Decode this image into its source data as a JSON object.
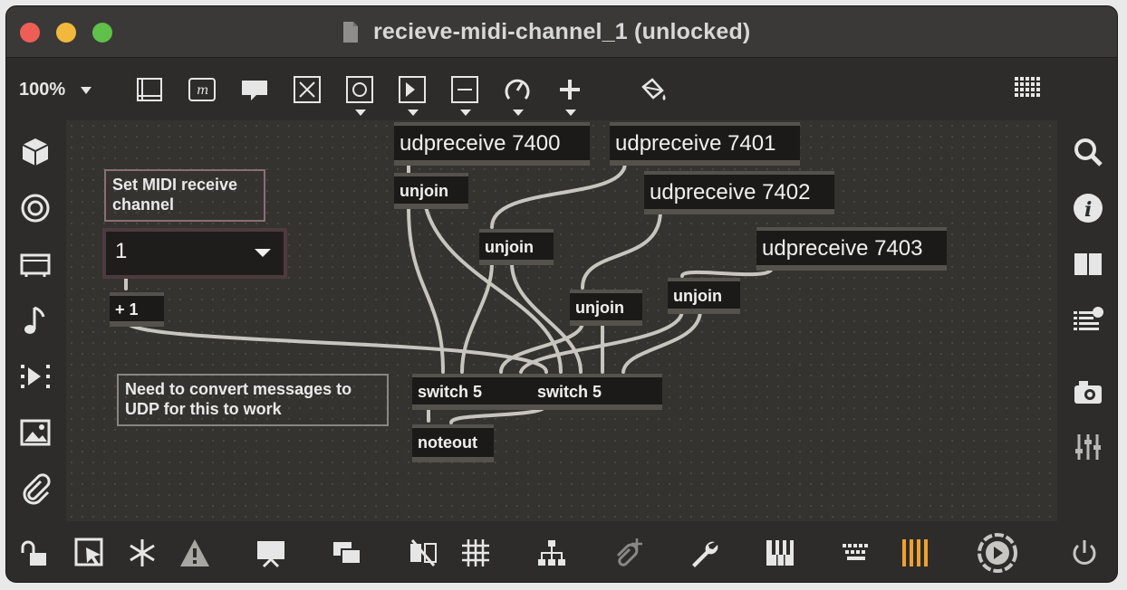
{
  "window": {
    "title": "recieve-midi-channel_1 (unlocked)"
  },
  "toolbar": {
    "zoom": "100%",
    "icons": [
      "presentation-frame-icon",
      "message-box-icon",
      "comment-icon",
      "toggle-icon",
      "button-object-icon",
      "number-box-icon",
      "slider-icon",
      "dial-icon",
      "add-object-icon",
      "paint-bucket-icon",
      "grid-dots-icon"
    ]
  },
  "left_sidebar": {
    "icons": [
      "package-cube-icon",
      "target-icon",
      "device-icon",
      "music-note-icon",
      "media-play-icon",
      "image-icon",
      "paperclip-icon"
    ]
  },
  "right_sidebar": {
    "icons": [
      "search-icon",
      "info-icon",
      "book-icon",
      "list-icon",
      "camera-icon",
      "sliders-icon"
    ]
  },
  "patch": {
    "objects": [
      {
        "id": "udp7400",
        "text": "udpreceive 7400"
      },
      {
        "id": "udp7401",
        "text": "udpreceive 7401"
      },
      {
        "id": "udp7402",
        "text": "udpreceive 7402"
      },
      {
        "id": "udp7403",
        "text": "udpreceive 7403"
      },
      {
        "id": "unjoin1",
        "text": "unjoin"
      },
      {
        "id": "unjoin2",
        "text": "unjoin"
      },
      {
        "id": "unjoin3",
        "text": "unjoin"
      },
      {
        "id": "unjoin4",
        "text": "unjoin"
      },
      {
        "id": "plus1",
        "text": "+ 1"
      },
      {
        "id": "switch1",
        "text": "switch 5"
      },
      {
        "id": "switch2",
        "text": "switch 5"
      },
      {
        "id": "noteout",
        "text": "noteout"
      }
    ],
    "comments": [
      {
        "id": "c1",
        "text": "Set MIDI receive channel"
      },
      {
        "id": "c2",
        "text": "Need to convert messages to UDP for this to work"
      }
    ],
    "umenu": {
      "value": "1"
    }
  },
  "bottom_bar": {
    "icons": [
      "lock-icon",
      "edit-pointer-icon",
      "freeze-icon",
      "warning-icon",
      "presentation-icon",
      "windows-icon",
      "hide-icon",
      "grid-icon",
      "hierarchy-icon",
      "paperclip-add-icon",
      "wrench-icon",
      "piano-icon",
      "keyboard-icon",
      "bars-icon",
      "play-icon",
      "power-icon"
    ]
  },
  "colors": {
    "accent_orange": "#f0a030",
    "inlet_red": "#e08080",
    "inlet_blue": "#80c8e0",
    "outlet_yellow": "#d8d070"
  }
}
